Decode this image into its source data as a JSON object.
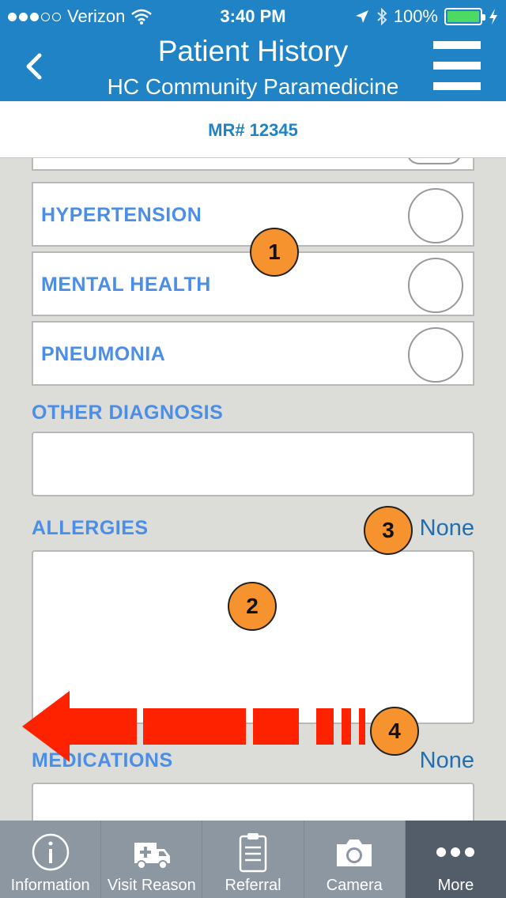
{
  "status_bar": {
    "carrier": "Verizon",
    "time": "3:40 PM",
    "battery": "100%"
  },
  "header": {
    "title": "Patient History",
    "subtitle": "HC Community Paramedicine",
    "back_icon": "chevron-left-icon",
    "menu_icon": "hamburger-menu-icon"
  },
  "record": {
    "mr_number": "MR# 12345"
  },
  "diagnoses": [
    {
      "label": "HYPERTENSION",
      "selected": false
    },
    {
      "label": "MENTAL HEALTH",
      "selected": false
    },
    {
      "label": "PNEUMONIA",
      "selected": false
    }
  ],
  "other_diagnosis": {
    "label": "OTHER DIAGNOSIS",
    "value": ""
  },
  "allergies": {
    "label": "ALLERGIES",
    "none_label": "None",
    "value": ""
  },
  "medications": {
    "label": "MEDICATIONS",
    "none_label": "None",
    "value": ""
  },
  "annotations": [
    "1",
    "2",
    "3",
    "4"
  ],
  "colors": {
    "header_bg": "#1f83c5",
    "label_blue": "#4a8ee8",
    "badge_orange": "#f7932e",
    "arrow_red": "#ff2200",
    "tabbar_bg": "#8d97a2",
    "tab_active_bg": "#525d69"
  },
  "tabs": [
    {
      "label": "Information",
      "icon": "info-icon",
      "active": false
    },
    {
      "label": "Visit Reason",
      "icon": "ambulance-icon",
      "active": false
    },
    {
      "label": "Referral",
      "icon": "clipboard-icon",
      "active": false
    },
    {
      "label": "Camera",
      "icon": "camera-icon",
      "active": false
    },
    {
      "label": "More",
      "icon": "more-dots-icon",
      "active": true
    }
  ]
}
